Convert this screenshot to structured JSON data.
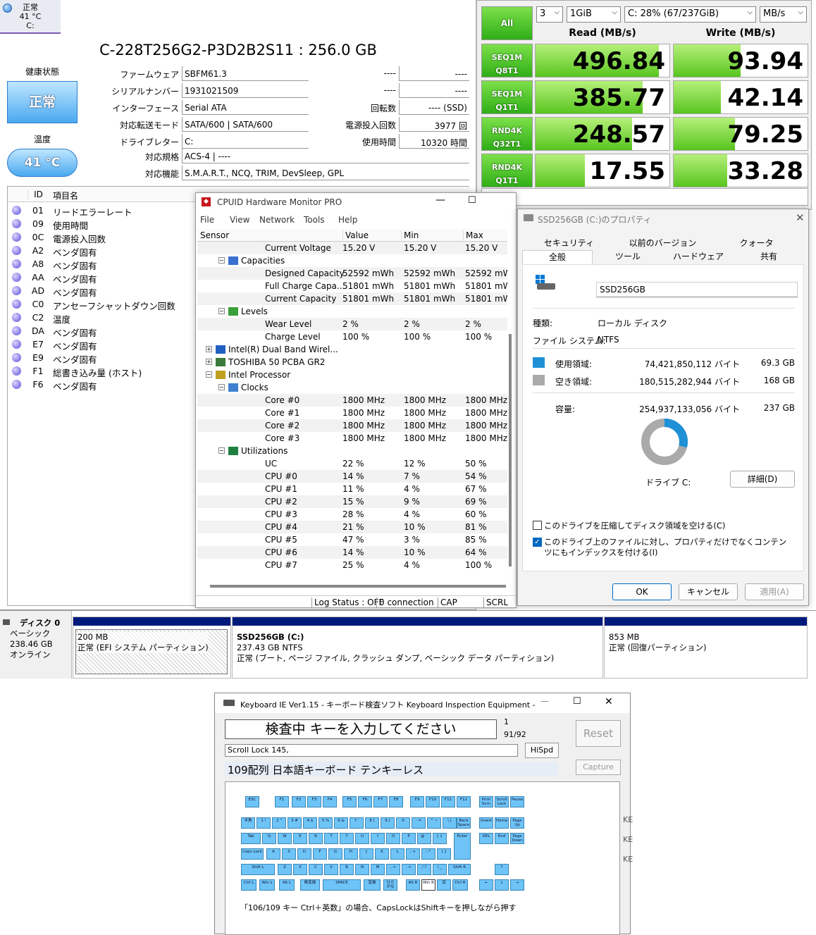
{
  "cdi": {
    "tab": {
      "status": "正常",
      "temp": "41 °C",
      "drive": "C:"
    },
    "model": "C-228T256G2-P3D2B2S11 : 256.0 GB",
    "health_label": "健康状態",
    "health_value": "正常",
    "temp_label": "温度",
    "temp_value": "41 °C",
    "left_fields": [
      {
        "label": "ファームウェア",
        "value": "SBFM61.3"
      },
      {
        "label": "シリアルナンバー",
        "value": "1931021509"
      },
      {
        "label": "インターフェース",
        "value": "Serial ATA"
      },
      {
        "label": "対応転送モード",
        "value": "SATA/600 | SATA/600"
      },
      {
        "label": "ドライブレター",
        "value": "C:"
      }
    ],
    "right_fields": [
      {
        "label": "----",
        "value": "----"
      },
      {
        "label": "----",
        "value": "----"
      },
      {
        "label": "回転数",
        "value": "---- (SSD)"
      },
      {
        "label": "電源投入回数",
        "value": "3977 回"
      },
      {
        "label": "使用時間",
        "value": "10320 時間"
      }
    ],
    "standard_label": "対応規格",
    "standard_value": "ACS-4 | ----",
    "features_label": "対応機能",
    "features_value": "S.M.A.R.T., NCQ, TRIM, DevSleep, GPL",
    "smart_header": {
      "id": "ID",
      "name": "項目名"
    },
    "smart_rows": [
      {
        "id": "01",
        "name": "リードエラーレート"
      },
      {
        "id": "09",
        "name": "使用時間"
      },
      {
        "id": "0C",
        "name": "電源投入回数"
      },
      {
        "id": "A2",
        "name": "ベンダ固有"
      },
      {
        "id": "A8",
        "name": "ベンダ固有"
      },
      {
        "id": "AA",
        "name": "ベンダ固有"
      },
      {
        "id": "AD",
        "name": "ベンダ固有"
      },
      {
        "id": "C0",
        "name": "アンセーフシャットダウン回数"
      },
      {
        "id": "C2",
        "name": "温度"
      },
      {
        "id": "DA",
        "name": "ベンダ固有"
      },
      {
        "id": "E7",
        "name": "ベンダ固有"
      },
      {
        "id": "E9",
        "name": "ベンダ固有"
      },
      {
        "id": "F1",
        "name": "総書き込み量 (ホスト)"
      },
      {
        "id": "F6",
        "name": "ベンダ固有"
      }
    ]
  },
  "cdm": {
    "all_label": "All",
    "count": "3",
    "size": "1GiB",
    "drive": "C: 28% (67/237GiB)",
    "unit": "MB/s",
    "read_header": "Read (MB/s)",
    "write_header": "Write (MB/s)",
    "tests": [
      {
        "l1": "SEQ1M",
        "l2": "Q8T1",
        "read": "496.84",
        "write": "93.94",
        "read_fill": 0.92,
        "write_fill": 0.5
      },
      {
        "l1": "SEQ1M",
        "l2": "Q1T1",
        "read": "385.77",
        "write": "42.14",
        "read_fill": 0.8,
        "write_fill": 0.35
      },
      {
        "l1": "RND4K",
        "l2": "Q32T1",
        "read": "248.57",
        "write": "79.25",
        "read_fill": 0.72,
        "write_fill": 0.46
      },
      {
        "l1": "RND4K",
        "l2": "Q1T1",
        "read": "17.55",
        "write": "33.28",
        "read_fill": 0.37,
        "write_fill": 0.4
      }
    ]
  },
  "hwm": {
    "title": "CPUID Hardware Monitor PRO",
    "menu": [
      "File",
      "View",
      "Network",
      "Tools",
      "Help"
    ],
    "cols": [
      "Sensor",
      "Value",
      "Min",
      "Max"
    ],
    "rows": [
      {
        "lvl": 3,
        "name": "Current Voltage",
        "v": "15.20 V",
        "mn": "15.20 V",
        "mx": "15.20 V"
      },
      {
        "lvl": 2,
        "name": "Capacities",
        "v": "",
        "mn": "",
        "mx": "",
        "icon": "capacities"
      },
      {
        "lvl": 3,
        "name": "Designed Capacity",
        "v": "52592 mWh",
        "mn": "52592 mWh",
        "mx": "52592 mWh"
      },
      {
        "lvl": 3,
        "name": "Full Charge Capa...",
        "v": "51801 mWh",
        "mn": "51801 mWh",
        "mx": "51801 mWh"
      },
      {
        "lvl": 3,
        "name": "Current Capacity",
        "v": "51801 mWh",
        "mn": "51801 mWh",
        "mx": "51801 mWh"
      },
      {
        "lvl": 2,
        "name": "Levels",
        "v": "",
        "mn": "",
        "mx": "",
        "icon": "levels"
      },
      {
        "lvl": 3,
        "name": "Wear Level",
        "v": "2 %",
        "mn": "2 %",
        "mx": "2 %"
      },
      {
        "lvl": 3,
        "name": "Charge Level",
        "v": "100 %",
        "mn": "100 %",
        "mx": "100 %"
      },
      {
        "lvl": 1,
        "name": "Intel(R) Dual Band Wirel...",
        "v": "",
        "mn": "",
        "mx": "",
        "icon": "network"
      },
      {
        "lvl": 1,
        "name": "TOSHIBA 50 PCBA GR2",
        "v": "",
        "mn": "",
        "mx": "",
        "icon": "disk"
      },
      {
        "lvl": 1,
        "name": "Intel Processor",
        "v": "",
        "mn": "",
        "mx": "",
        "icon": "cpu"
      },
      {
        "lvl": 2,
        "name": "Clocks",
        "v": "",
        "mn": "",
        "mx": "",
        "icon": "clocks"
      },
      {
        "lvl": 3,
        "name": "Core #0",
        "v": "1800 MHz",
        "mn": "1800 MHz",
        "mx": "1800 MHz"
      },
      {
        "lvl": 3,
        "name": "Core #1",
        "v": "1800 MHz",
        "mn": "1800 MHz",
        "mx": "1800 MHz"
      },
      {
        "lvl": 3,
        "name": "Core #2",
        "v": "1800 MHz",
        "mn": "1800 MHz",
        "mx": "1800 MHz"
      },
      {
        "lvl": 3,
        "name": "Core #3",
        "v": "1800 MHz",
        "mn": "1800 MHz",
        "mx": "1800 MHz"
      },
      {
        "lvl": 2,
        "name": "Utilizations",
        "v": "",
        "mn": "",
        "mx": "",
        "icon": "utilizations"
      },
      {
        "lvl": 3,
        "name": "UC",
        "v": "22 %",
        "mn": "12 %",
        "mx": "50 %"
      },
      {
        "lvl": 3,
        "name": "CPU #0",
        "v": "14 %",
        "mn": "7 %",
        "mx": "54 %"
      },
      {
        "lvl": 3,
        "name": "CPU #1",
        "v": "11 %",
        "mn": "4 %",
        "mx": "67 %"
      },
      {
        "lvl": 3,
        "name": "CPU #2",
        "v": "15 %",
        "mn": "9 %",
        "mx": "69 %"
      },
      {
        "lvl": 3,
        "name": "CPU #3",
        "v": "28 %",
        "mn": "4 %",
        "mx": "60 %"
      },
      {
        "lvl": 3,
        "name": "CPU #4",
        "v": "21 %",
        "mn": "10 %",
        "mx": "81 %"
      },
      {
        "lvl": 3,
        "name": "CPU #5",
        "v": "47 %",
        "mn": "3 %",
        "mx": "85 %"
      },
      {
        "lvl": 3,
        "name": "CPU #6",
        "v": "14 %",
        "mn": "10 %",
        "mx": "64 %"
      },
      {
        "lvl": 3,
        "name": "CPU #7",
        "v": "25 %",
        "mn": "4 %",
        "mx": "100 %"
      }
    ],
    "status": {
      "log": "Log Status : OFF",
      "conn": "0 connection",
      "cap": "CAP",
      "scrl": "SCRL"
    }
  },
  "prop": {
    "title": "SSD256GB (C:)のプロパティ",
    "tabs_top": [
      "セキュリティ",
      "以前のバージョン",
      "クォータ"
    ],
    "tabs_bottom": [
      "全般",
      "ツール",
      "ハードウェア",
      "共有"
    ],
    "name": "SSD256GB",
    "type_label": "種類:",
    "type_value": "ローカル ディスク",
    "fs_label": "ファイル システム:",
    "fs_value": "NTFS",
    "used_label": "使用領域:",
    "used_bytes": "74,421,850,112 バイト",
    "used_gb": "69.3 GB",
    "free_label": "空き領域:",
    "free_bytes": "180,515,282,944 バイト",
    "free_gb": "168 GB",
    "cap_label": "容量:",
    "cap_bytes": "254,937,133,056 バイト",
    "cap_gb": "237 GB",
    "used_fraction": 0.29,
    "drive_label": "ドライブ C:",
    "details": "詳細(D)",
    "compress": "このドライブを圧縮してディスク領域を空ける(C)",
    "index": "このドライブ上のファイルに対し、プロパティだけでなくコンテンツにもインデックスを付ける(I)",
    "ok": "OK",
    "cancel": "キャンセル",
    "apply": "適用(A)"
  },
  "dm": {
    "disk": "ディスク 0",
    "type": "ベーシック",
    "size": "238.46 GB",
    "state": "オンライン",
    "p1_size": "200 MB",
    "p1_desc": "正常 (EFI システム パーティション)",
    "p2_name": "SSD256GB (C:)",
    "p2_size": "237.43 GB NTFS",
    "p2_desc": "正常 (ブート, ページ ファイル, クラッシュ ダンプ, ベーシック データ パーティション)",
    "p3_size": "853 MB",
    "p3_desc": "正常 (回復パーティション)"
  },
  "kb": {
    "title": "Keyboard IE Ver1.15 - キーボード検査ソフト Keyboard Inspection Equipment -",
    "status": "検査中 キーを入力してください",
    "count1": "1",
    "count2": "91/92",
    "reset": "Reset",
    "last": "Scroll Lock 145,",
    "hispd": "HiSpd",
    "layout": "109配列 日本語キーボード テンキーレス",
    "capture": "Capture",
    "note": "「106/109 キー Ctrl＋英数」の場合、CapsLockはShiftキーを押しながら押す",
    "rows": [
      [
        "ESC",
        "F1",
        "F2",
        "F3",
        "F4",
        "F5",
        "F6",
        "F7",
        "F8",
        "F9",
        "F10",
        "F11",
        "F12",
        "Print Scrn",
        "Scroll Lock",
        "Pause"
      ],
      [
        "半角",
        "1 !",
        "2 \"",
        "3 #",
        "4 $",
        "5 %",
        "6 &",
        "7 '",
        "8 (",
        "9 )",
        "0",
        "- =",
        "^ ~",
        "\\ |",
        "Back Space",
        "Insert",
        "Home",
        "Page Up"
      ],
      [
        "Tab",
        "Q",
        "W",
        "E",
        "R",
        "T",
        "Y",
        "U",
        "I",
        "O",
        "P",
        "@ `",
        "[ {",
        "Enter",
        "DEL",
        "End",
        "Page Down"
      ],
      [
        "Caps Lock",
        "A",
        "S",
        "D",
        "F",
        "G",
        "H",
        "J",
        "K",
        "L",
        "; +",
        ": *",
        "] }"
      ],
      [
        "Shift L",
        "Z",
        "X",
        "C",
        "V",
        "B",
        "N",
        "M",
        ", <",
        ". >",
        "/ ?",
        "\\ _",
        "Shift R",
        "↑"
      ],
      [
        "Ctrl L",
        "Win L",
        "Alt L",
        "無変換",
        "SPACE",
        "変換",
        "ひら がな",
        "Alt R",
        "Win R",
        "目",
        "Ctrl R",
        "←",
        "↓",
        "→"
      ]
    ]
  }
}
